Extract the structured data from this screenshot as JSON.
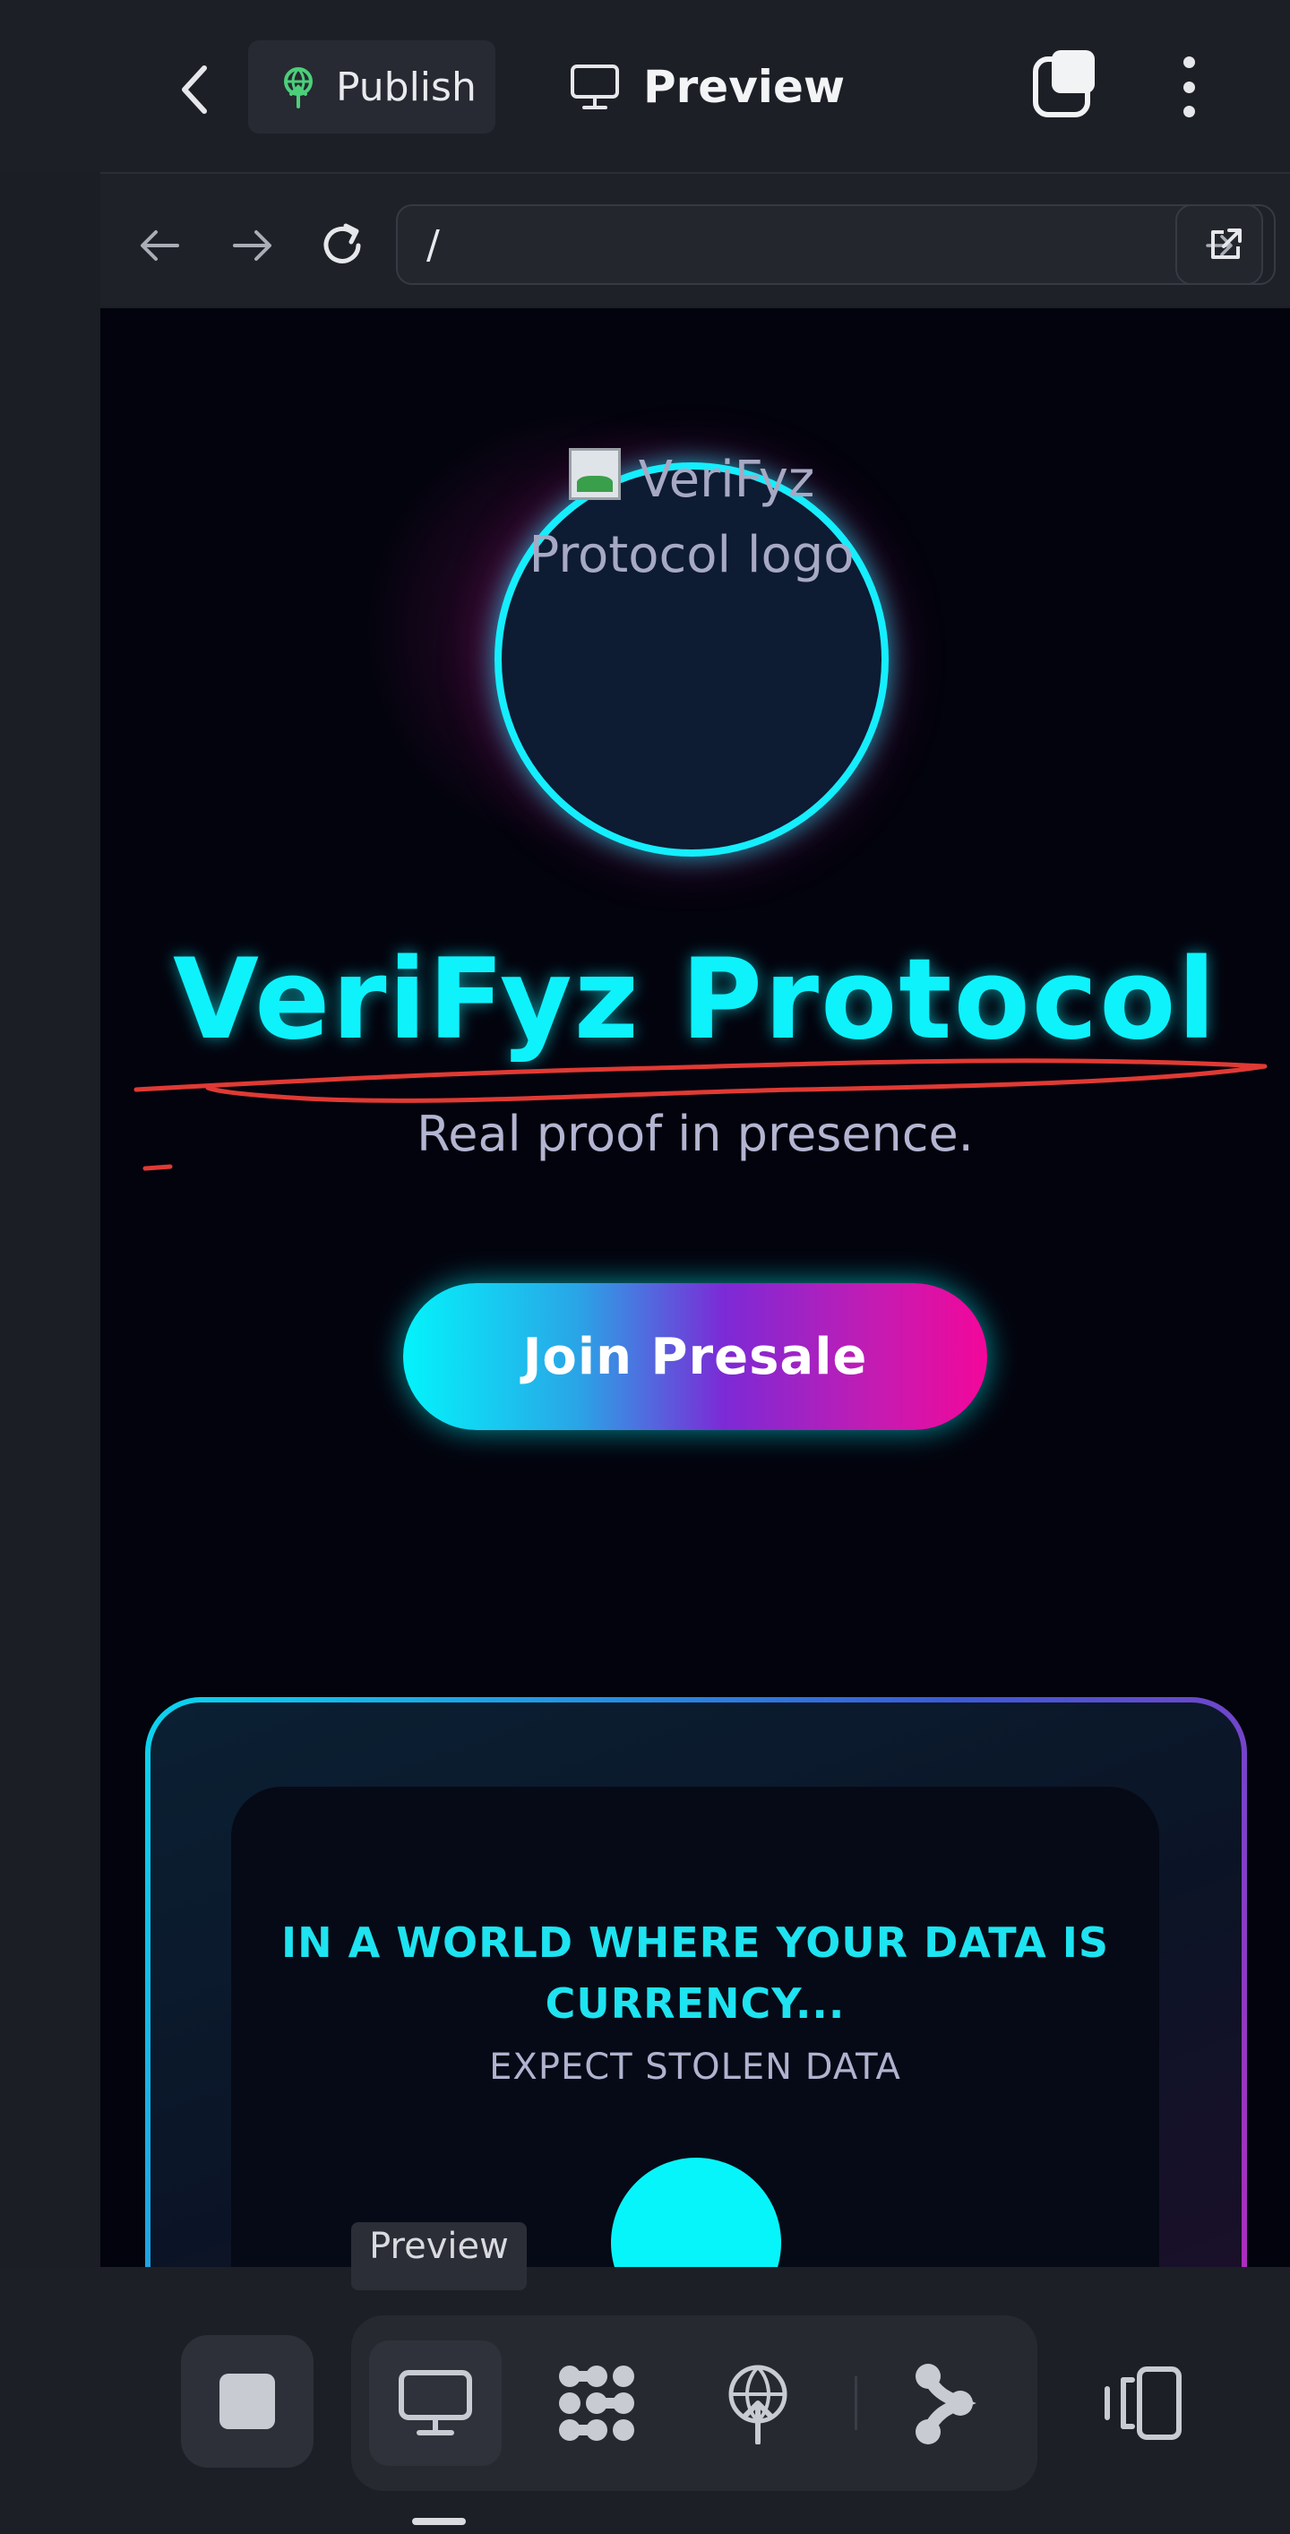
{
  "appbar": {
    "publish_label": "Publish",
    "preview_label": "Preview"
  },
  "browser": {
    "url": "/"
  },
  "hero": {
    "logo_alt": "VeriFyz Protocol logo",
    "title": "VeriFyz Protocol",
    "subtitle": "Real proof in presence.",
    "cta_label": "Join Presale"
  },
  "card": {
    "heading": "IN A WORLD WHERE YOUR DATA IS CURRENCY...",
    "subheading": "EXPECT STOLEN DATA"
  },
  "toolbar": {
    "tooltip": "Preview"
  },
  "icons": {
    "back": "chevron-left-icon",
    "publish": "broadcast-icon",
    "preview": "monitor-icon",
    "copy": "copy-icon",
    "more": "more-vertical-icon",
    "nav_back": "arrow-left-icon",
    "nav_forward": "arrow-right-icon",
    "reload": "reload-icon",
    "go": "arrow-right-icon",
    "external": "external-link-icon",
    "stop": "stop-icon",
    "desktop": "monitor-icon",
    "dots": "grid-dots-icon",
    "deploy": "globe-upload-icon",
    "share": "share-nodes-icon",
    "device": "device-switch-icon"
  },
  "colors": {
    "accent_cyan": "#0ef2fc",
    "accent_magenta": "#f3079a",
    "annotation_red": "#e03a34",
    "publish_green": "#4ccf7a"
  }
}
